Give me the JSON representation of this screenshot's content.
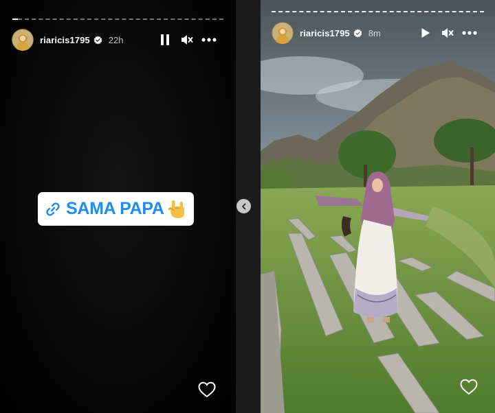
{
  "stories": {
    "left": {
      "username": "riaricis1795",
      "time": "22h",
      "link_sticker": {
        "text": "SAMA PAPA",
        "emoji_icon": "rock-on-hand-icon"
      }
    },
    "right": {
      "username": "riaricis1795",
      "time": "8m"
    }
  },
  "icons": {
    "pause": "pause-icon",
    "play": "play-icon",
    "mute": "speaker-muted-icon",
    "more": "more-dots-icon",
    "like": "heart-icon",
    "verified": "verified-badge-icon",
    "prev": "chevron-left-icon",
    "link": "link-icon"
  },
  "colors": {
    "link_text": "#1f8cf0",
    "verified_badge": "#ffffff",
    "page_background": "#1b1b1b"
  }
}
